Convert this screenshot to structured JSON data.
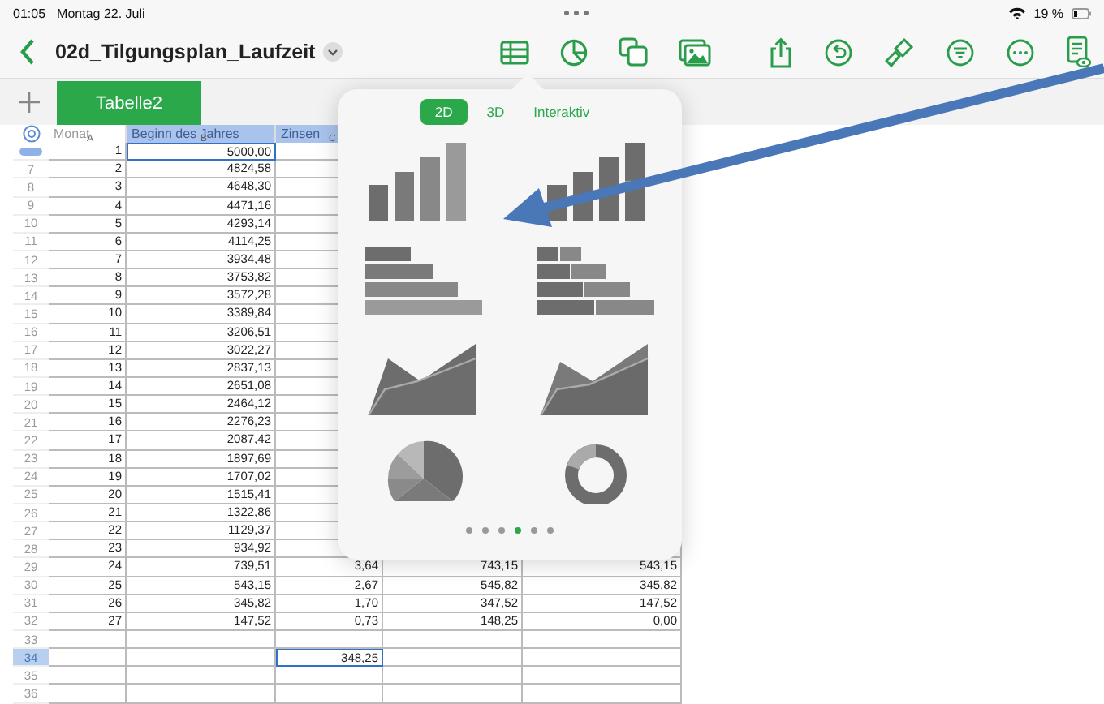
{
  "status_bar": {
    "time": "01:05",
    "date": "Montag 22. Juli",
    "battery": "19 %"
  },
  "toolbar": {
    "title": "02d_Tilgungsplan_Laufzeit"
  },
  "sheet_tabs": [
    {
      "label": "Tabelle2",
      "selected": true
    }
  ],
  "table": {
    "columns": [
      {
        "label": "Monat",
        "letter": "A",
        "highlighted": false
      },
      {
        "label": "Beginn des Jahres",
        "letter": "B",
        "highlighted": true
      },
      {
        "label": "Zinsen",
        "letter": "C",
        "highlighted": true
      }
    ],
    "rows": [
      {
        "selected": true,
        "monat": "1",
        "beginn": "5000,00",
        "beginn_selected": true
      },
      {
        "number": "7",
        "selected": false,
        "monat": "2",
        "beginn": "4824,58"
      },
      {
        "number": "8",
        "selected": false,
        "monat": "3",
        "beginn": "4648,30"
      },
      {
        "number": "9",
        "selected": false,
        "monat": "4",
        "beginn": "4471,16"
      },
      {
        "number": "10",
        "selected": false,
        "monat": "5",
        "beginn": "4293,14"
      },
      {
        "number": "11",
        "selected": false,
        "monat": "6",
        "beginn": "4114,25"
      },
      {
        "number": "12",
        "selected": false,
        "monat": "7",
        "beginn": "3934,48"
      },
      {
        "number": "13",
        "selected": false,
        "monat": "8",
        "beginn": "3753,82"
      },
      {
        "number": "14",
        "selected": false,
        "monat": "9",
        "beginn": "3572,28"
      },
      {
        "number": "15",
        "selected": false,
        "monat": "10",
        "beginn": "3389,84"
      },
      {
        "number": "16",
        "selected": false,
        "monat": "11",
        "beginn": "3206,51"
      },
      {
        "number": "17",
        "selected": false,
        "monat": "12",
        "beginn": "3022,27"
      },
      {
        "number": "18",
        "selected": false,
        "monat": "13",
        "beginn": "2837,13"
      },
      {
        "number": "19",
        "selected": false,
        "monat": "14",
        "beginn": "2651,08"
      },
      {
        "number": "20",
        "selected": false,
        "monat": "15",
        "beginn": "2464,12"
      },
      {
        "number": "21",
        "selected": false,
        "monat": "16",
        "beginn": "2276,23"
      },
      {
        "number": "22",
        "selected": false,
        "monat": "17",
        "beginn": "2087,42"
      },
      {
        "number": "23",
        "selected": false,
        "monat": "18",
        "beginn": "1897,69"
      },
      {
        "number": "24",
        "selected": false,
        "monat": "19",
        "beginn": "1707,02"
      },
      {
        "number": "25",
        "selected": false,
        "monat": "20",
        "beginn": "1515,41"
      },
      {
        "number": "26",
        "selected": false,
        "monat": "21",
        "beginn": "1322,86"
      },
      {
        "number": "27",
        "selected": false,
        "monat": "22",
        "beginn": "1129,37"
      },
      {
        "number": "28",
        "selected": false,
        "monat": "23",
        "beginn": "934,92"
      },
      {
        "number": "29",
        "selected": false,
        "monat": "24",
        "beginn": "739,51",
        "zinsen": "3,64",
        "column_4": "743,15",
        "column_5": "543,15"
      },
      {
        "number": "30",
        "selected": false,
        "monat": "25",
        "beginn": "543,15",
        "zinsen": "2,67",
        "column_4": "545,82",
        "column_5": "345,82"
      },
      {
        "number": "31",
        "selected": false,
        "monat": "26",
        "beginn": "345,82",
        "zinsen": "1,70",
        "column_4": "347,52",
        "column_5": "147,52"
      },
      {
        "number": "32",
        "selected": false,
        "monat": "27",
        "beginn": "147,52",
        "zinsen": "0,73",
        "column_4": "148,25",
        "column_5": "0,00"
      },
      {
        "number": "33",
        "selected": false
      },
      {
        "number": "34",
        "selected": true,
        "zinsen": "348,25",
        "zinsen_selected": true
      },
      {
        "number": "35",
        "selected": false
      },
      {
        "number": "36",
        "selected": false
      }
    ]
  },
  "chart_popover": {
    "tabs": [
      {
        "label": "2D",
        "selected": true
      },
      {
        "label": "3D",
        "selected": false
      },
      {
        "label": "Interaktiv",
        "selected": false
      }
    ],
    "pages": [
      {
        "selected": false
      },
      {
        "selected": false
      },
      {
        "selected": false
      },
      {
        "selected": true
      },
      {
        "selected": false
      },
      {
        "selected": false
      }
    ]
  }
}
